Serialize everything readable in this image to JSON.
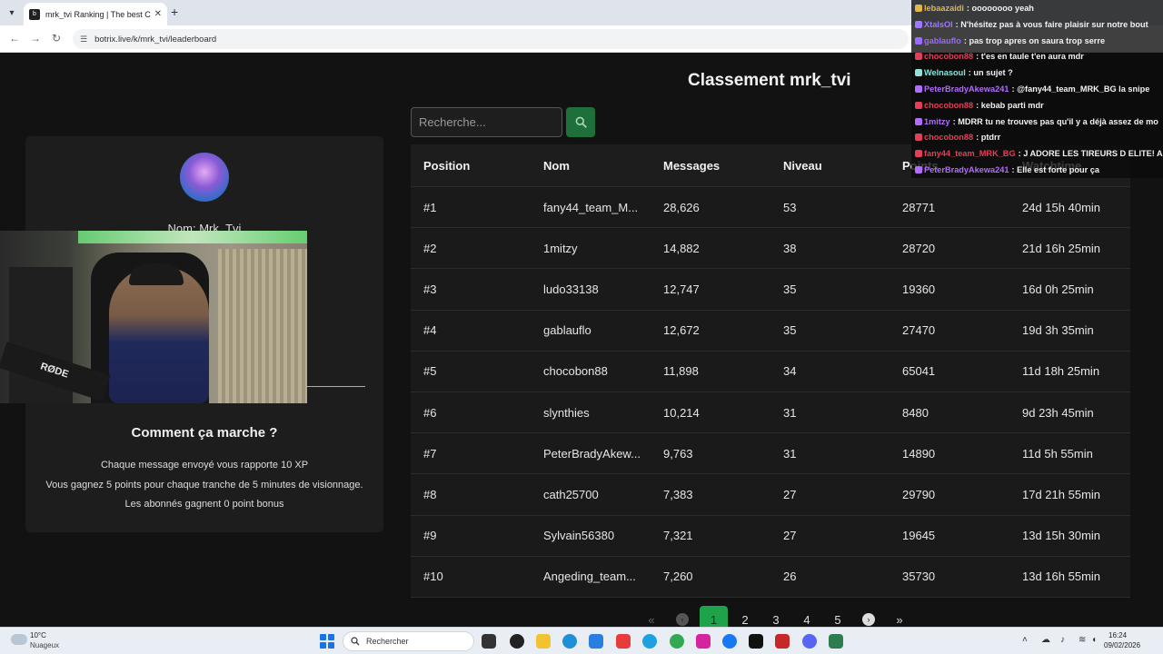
{
  "browser": {
    "tab_title": "mrk_tvi Ranking | The best Chat",
    "tab_close": "✕",
    "new_tab": "+",
    "url": "botrix.live/k/mrk_tvi/leaderboard"
  },
  "page": {
    "title": "Classement mrk_tvi",
    "search_placeholder": "Recherche..."
  },
  "profile": {
    "name": "Nom: Mrk_Tvi"
  },
  "webcam": {
    "mic_label": "RØDE"
  },
  "how_it_works": {
    "title": "Comment ça marche ?",
    "lines": [
      "Chaque message envoyé vous rapporte 10 XP",
      "Vous gagnez 5 points pour chaque tranche de 5 minutes de visionnage.",
      "Les abonnés gagnent 0 point bonus"
    ]
  },
  "table": {
    "headers": [
      "Position",
      "Nom",
      "Messages",
      "Niveau",
      "Points",
      "Watchtime"
    ],
    "rows": [
      [
        "#1",
        "fany44_team_M...",
        "28,626",
        "53",
        "28771",
        "24d 15h 40min"
      ],
      [
        "#2",
        "1mitzy",
        "14,882",
        "38",
        "28720",
        "21d 16h 25min"
      ],
      [
        "#3",
        "ludo33138",
        "12,747",
        "35",
        "19360",
        "16d 0h 25min"
      ],
      [
        "#4",
        "gablauflo",
        "12,672",
        "35",
        "27470",
        "19d 3h 35min"
      ],
      [
        "#5",
        "chocobon88",
        "11,898",
        "34",
        "65041",
        "11d 18h 25min"
      ],
      [
        "#6",
        "slynthies",
        "10,214",
        "31",
        "8480",
        "9d 23h 45min"
      ],
      [
        "#7",
        "PeterBradyAkew...",
        "9,763",
        "31",
        "14890",
        "11d 5h 55min"
      ],
      [
        "#8",
        "cath25700",
        "7,383",
        "27",
        "29790",
        "17d 21h 55min"
      ],
      [
        "#9",
        "Sylvain56380",
        "7,321",
        "27",
        "19645",
        "13d 15h 30min"
      ],
      [
        "#10",
        "Angeding_team...",
        "7,260",
        "26",
        "35730",
        "13d 16h 55min"
      ]
    ]
  },
  "pagination": {
    "first": "«",
    "prev": "‹",
    "pages": [
      "1",
      "2",
      "3",
      "4",
      "5"
    ],
    "active_page": "1",
    "next": "›",
    "last": "»"
  },
  "chat": {
    "lines": [
      {
        "user": "lebaazaidi",
        "msg": ": oooooooo yeah",
        "color": "#e0b84a"
      },
      {
        "user": "XtalsOl",
        "msg": ": N'hésitez pas à vous faire plaisir sur notre bout",
        "color": "#a078ff"
      },
      {
        "user": "gablauflo",
        "msg": ": pas trop apres on saura trop serre",
        "color": "#9a6bff"
      },
      {
        "user": "chocobon88",
        "msg": ": t'es en taule t'en aura mdr",
        "color": "#e0405a"
      },
      {
        "user": "Welnasoul",
        "msg": ": un sujet ?",
        "color": "#8fe3d6"
      },
      {
        "user": "PeterBradyAkewa241",
        "msg": ": @fany44_team_MRK_BG la snipe",
        "color": "#b26bff"
      },
      {
        "user": "chocobon88",
        "msg": ": kebab parti mdr",
        "color": "#e0405a"
      },
      {
        "user": "1mitzy",
        "msg": ": MDRR tu ne trouves pas qu'il y a déjà assez de mo",
        "color": "#b26bff"
      },
      {
        "user": "chocobon88",
        "msg": ": ptdrr",
        "color": "#e0405a"
      },
      {
        "user": "fany44_team_MRK_BG",
        "msg": ": J ADORE LES TIREURS D ELITE! A",
        "color": "#e0405a"
      },
      {
        "user": "PeterBradyAkewa241",
        "msg": ": Elle est forte pour ça",
        "color": "#b26bff"
      }
    ]
  },
  "taskbar": {
    "temperature": "10°C",
    "condition": "Nuageux",
    "search_label": "Rechercher",
    "time": "16:24",
    "date": "09/02/2026"
  },
  "colors": {
    "accent_green": "#1fa34a",
    "search_button": "#1f6f3a",
    "table_bg": "#1a1a1a"
  }
}
